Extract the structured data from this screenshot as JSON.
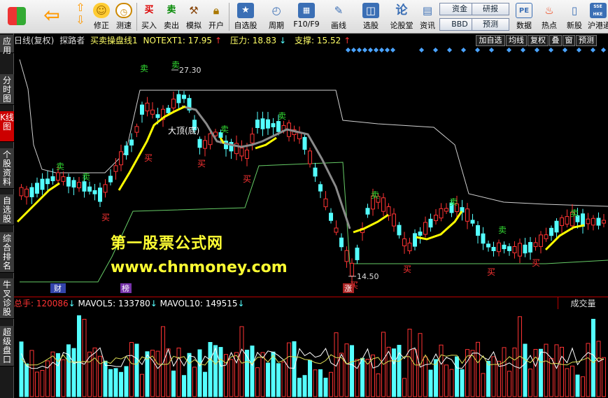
{
  "toolbar": {
    "buttons": [
      {
        "label": "买入",
        "icon": "buy-icon"
      },
      {
        "label": "卖出",
        "icon": "sell-icon"
      },
      {
        "label": "模拟",
        "icon": "hammer-icon"
      },
      {
        "label": "开户",
        "icon": "lock-icon"
      },
      {
        "label": "修正",
        "icon": "fix-icon"
      },
      {
        "label": "测速",
        "icon": "clock-icon"
      },
      {
        "label": "自选股",
        "icon": "star-icon"
      },
      {
        "label": "周期",
        "icon": "cycle-icon"
      },
      {
        "label": "F10/F9",
        "icon": "f10-icon"
      },
      {
        "label": "画线",
        "icon": "pen-icon"
      },
      {
        "label": "选股",
        "icon": "screen-icon"
      },
      {
        "label": "论股堂",
        "icon": "forum-icon"
      },
      {
        "label": "资讯",
        "icon": "news-icon"
      },
      {
        "label": "数据",
        "icon": "pe-icon"
      },
      {
        "label": "热点",
        "icon": "fire-icon"
      },
      {
        "label": "新股",
        "icon": "newstock-icon"
      },
      {
        "label": "沪港通",
        "icon": "hk-icon"
      }
    ],
    "small": [
      "资金",
      "BBD",
      "研报",
      "预测"
    ],
    "pe_text": "PE",
    "hk_text": "SSE HKE"
  },
  "sidetabs": [
    "应用",
    "分时图",
    "K线图",
    "个股资料",
    "自选股",
    "综合排名",
    "牛叉诊股",
    "超级盘口"
  ],
  "infobar": {
    "period": "日线(复权)",
    "user": "探路者",
    "indicator": "买卖操盘线1",
    "notext": "NOTEXT1: 17.95",
    "pressure": "压力: 18.83",
    "support": "支撑: 15.52"
  },
  "right_buttons": [
    "加自选",
    "均线",
    "复权",
    "叠",
    "窗",
    "预测"
  ],
  "chart": {
    "high_label": "27.30",
    "low_label": "14.50",
    "top_label": "大顶(底)",
    "markers": {
      "buy": "买",
      "sell": "卖",
      "cai": "财",
      "bang": "榜",
      "zhang": "涨"
    }
  },
  "watermark": {
    "line1": "第一股票公式网",
    "line2": "www.chnmoney.com"
  },
  "volume": {
    "total": "总手: 120086",
    "mavol5": "MAVOL5: 133780",
    "mavol10": "MAVOL10: 149515",
    "name": "成交量"
  },
  "colors": {
    "up": "#ff3333",
    "down": "#54ffff",
    "buy_line": "#ffff00",
    "sell_line": "#888888",
    "pressure": "#cccccc",
    "support": "#66cc66"
  }
}
